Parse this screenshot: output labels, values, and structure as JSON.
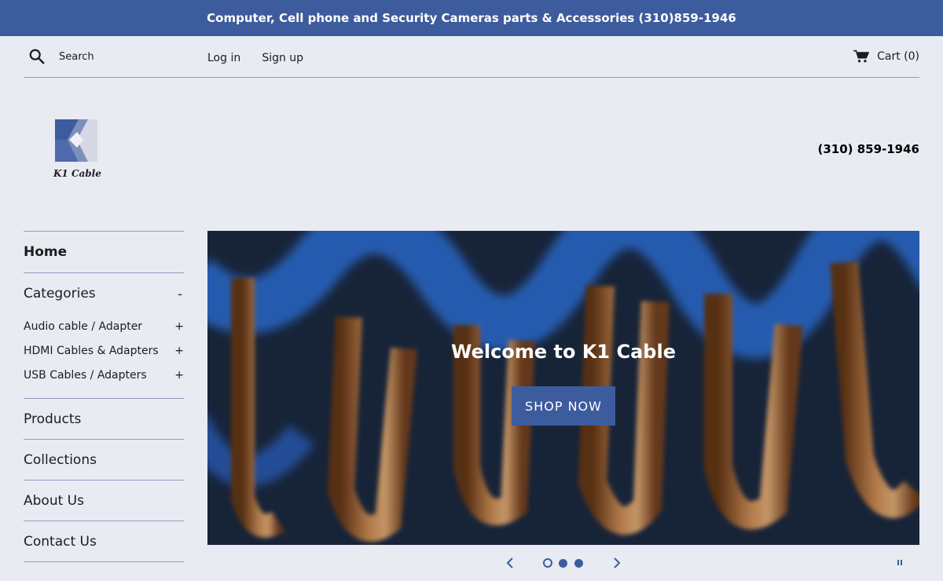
{
  "announcement": "Computer, Cell phone and Security Cameras parts & Accessories (310)859-1946",
  "search": {
    "placeholder": "Search",
    "icon": "search-icon"
  },
  "account": {
    "login": "Log in",
    "signup": "Sign up"
  },
  "cart": {
    "label": "Cart (0)",
    "icon": "cart-icon"
  },
  "logo": {
    "text": "K1 Cable"
  },
  "header_phone": "(310) 859-1946",
  "sidebar": {
    "home": "Home",
    "categories": {
      "label": "Categories",
      "toggle": "-",
      "items": [
        {
          "label": "Audio cable / Adapter",
          "toggle": "+"
        },
        {
          "label": "HDMI Cables & Adapters",
          "toggle": "+"
        },
        {
          "label": "USB Cables / Adapters",
          "toggle": "+"
        }
      ]
    },
    "products": "Products",
    "collections": "Collections",
    "about": "About Us",
    "contact": "Contact Us"
  },
  "hero": {
    "title": "Welcome to K1 Cable",
    "button": "SHOP NOW"
  },
  "slider": {
    "slide_count": 3,
    "active_slide": 1
  },
  "colors": {
    "accent": "#3d5c9e",
    "background": "#e8ebf2",
    "divider": "#8f9cc2"
  }
}
